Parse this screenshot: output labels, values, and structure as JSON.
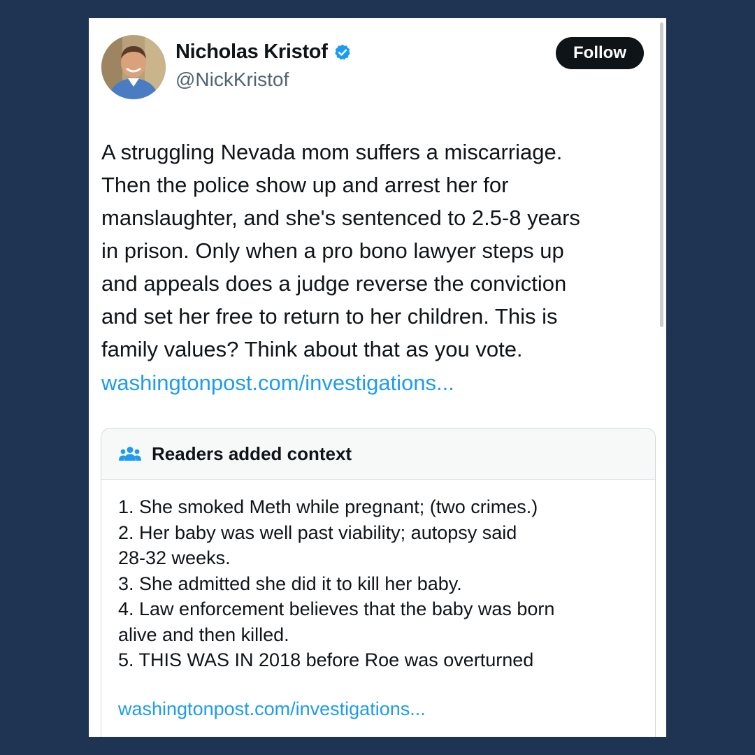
{
  "author": {
    "name": "Nicholas Kristof",
    "handle": "@NickKristof",
    "verified": true
  },
  "follow_button": {
    "label": "Follow"
  },
  "tweet": {
    "lines": [
      "A struggling Nevada mom suffers a miscarriage.",
      "Then the police show up and arrest her for",
      "manslaughter, and she's sentenced to 2.5-8 years",
      "in prison. Only when a pro bono lawyer steps up",
      "and appeals does a judge reverse the conviction",
      "and set her free to return to her children. This is",
      "family values? Think about that as you vote."
    ],
    "link": "washingtonpost.com/investigations..."
  },
  "community_note": {
    "title": "Readers added context",
    "lines": [
      "1. She smoked Meth while pregnant; (two crimes.)",
      "2. Her baby was well past viability; autopsy said",
      "28-32 weeks.",
      "3. She admitted she did it to kill her baby.",
      "4. Law enforcement believes that the baby was born",
      "alive and then killed.",
      "5. THIS WAS IN 2018 before Roe was overturned"
    ],
    "link": "washingtonpost.com/investigations..."
  },
  "icons": {
    "verified": "verified-badge-icon",
    "readers": "people-group-icon"
  },
  "colors": {
    "background": "#1e3452",
    "link": "#1d9bf0",
    "verified": "#1d9bf0",
    "text": "#0f1419",
    "secondary_text": "#536471",
    "follow_button_bg": "#0f1419"
  }
}
